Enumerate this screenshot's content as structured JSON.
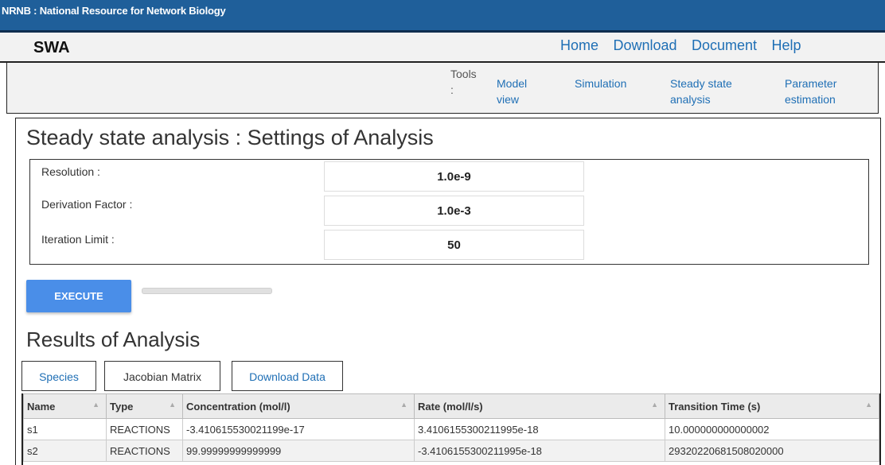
{
  "topbar": {
    "title": "NRNB : National Resource for Network Biology"
  },
  "navbar": {
    "app_name": "SWA",
    "links": [
      "Home",
      "Download",
      "Document",
      "Help"
    ]
  },
  "toolbar": {
    "label": "Tools\n:",
    "tools": [
      "Model\nview",
      "Simulation",
      "Steady state\nanalysis",
      "Parameter\nestimation"
    ]
  },
  "settings": {
    "title": "Steady state analysis : Settings of Analysis",
    "fields": [
      {
        "label": "Resolution :",
        "value": "1.0e-9"
      },
      {
        "label": "Derivation Factor :",
        "value": "1.0e-3"
      },
      {
        "label": "Iteration Limit :",
        "value": "50"
      }
    ],
    "execute_label": "EXECUTE",
    "progress": 0
  },
  "results": {
    "title": "Results of Analysis",
    "tabs": [
      "Species",
      "Jacobian Matrix",
      "Download Data"
    ],
    "columns": [
      "Name",
      "Type",
      "Concentration (mol/l)",
      "Rate (mol/l/s)",
      "Transition Time (s)"
    ],
    "rows": [
      [
        "s1",
        "REACTIONS",
        "-3.410615530021199e-17",
        "3.4106155300211995e-18",
        "10.000000000000002"
      ],
      [
        "s2",
        "REACTIONS",
        "99.99999999999999",
        "-3.4106155300211995e-18",
        "29320220681508020000"
      ]
    ]
  },
  "colors": {
    "accent": "#1f6fb5",
    "header_bg": "#1f5f9a",
    "button": "#4a8ee8"
  }
}
